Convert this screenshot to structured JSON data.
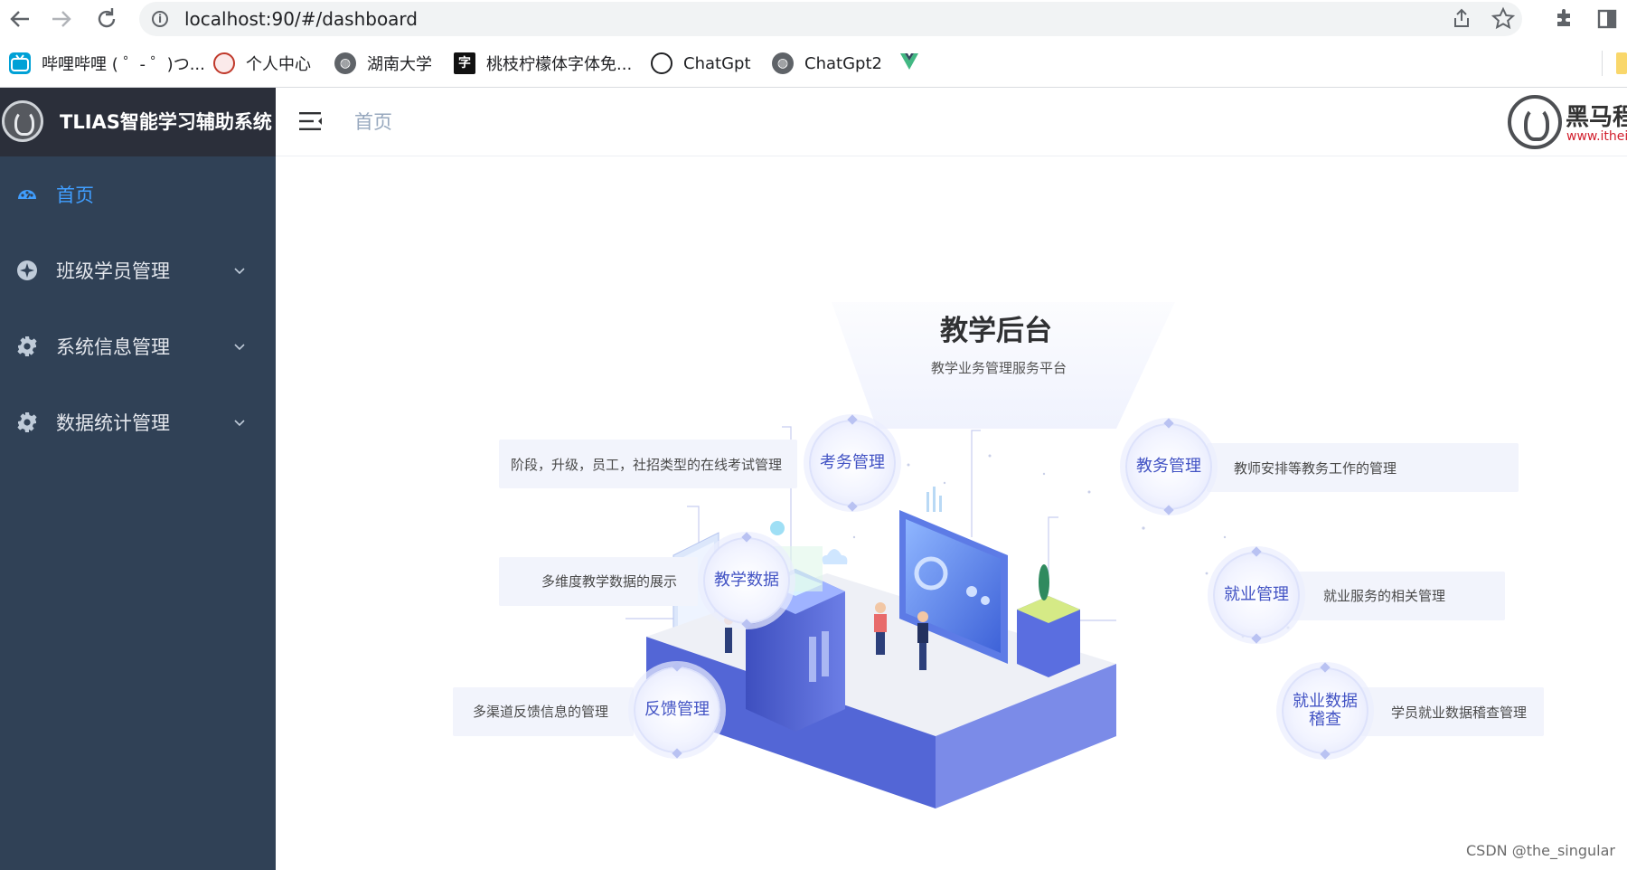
{
  "browser": {
    "url": "localhost:90/#/dashboard",
    "bookmarks": [
      {
        "label": "哔哩哔哩 ( ゜- ゜)つ...",
        "icon": "bilibili-icon",
        "color": "#00a1d6"
      },
      {
        "label": "个人中心",
        "icon": "university-seal-icon",
        "color": "#c0392b"
      },
      {
        "label": "湖南大学",
        "icon": "globe-icon",
        "color": "#5f6368"
      },
      {
        "label": "桃枝柠檬体字体免...",
        "icon": "zi-character-icon",
        "color": "#111111"
      },
      {
        "label": "ChatGpt",
        "icon": "openai-icon",
        "color": "#202124"
      },
      {
        "label": "ChatGpt2",
        "icon": "globe-icon",
        "color": "#5f6368"
      },
      {
        "label": "",
        "icon": "vue-icon",
        "color": "#42b883"
      }
    ]
  },
  "app": {
    "title": "TLIAS智能学习辅助系统",
    "breadcrumb": "首页",
    "corp_name": "黑马程",
    "corp_url": "www.itheir"
  },
  "sidebar": {
    "items": [
      {
        "label": "首页",
        "icon": "dashboard-icon",
        "active": true,
        "has_children": false
      },
      {
        "label": "班级学员管理",
        "icon": "compass-icon",
        "active": false,
        "has_children": true
      },
      {
        "label": "系统信息管理",
        "icon": "gear-icon",
        "active": false,
        "has_children": true
      },
      {
        "label": "数据统计管理",
        "icon": "gear-icon",
        "active": false,
        "has_children": true
      }
    ]
  },
  "dashboard": {
    "title": "教学后台",
    "subtitle": "教学业务管理服务平台",
    "features": [
      {
        "label": "考务管理",
        "desc": "阶段，升级，员工，社招类型的在线考试管理"
      },
      {
        "label": "教学数据",
        "desc": "多维度教学数据的展示"
      },
      {
        "label": "反馈管理",
        "desc": "多渠道反馈信息的管理"
      },
      {
        "label": "教务管理",
        "desc": "教师安排等教务工作的管理"
      },
      {
        "label": "就业管理",
        "desc": "就业服务的相关管理"
      },
      {
        "label": "就业数据\n稽查",
        "desc": "学员就业数据稽查管理"
      }
    ]
  },
  "watermark": "CSDN @the_singular",
  "colors": {
    "sidebar_bg": "#304156",
    "brand_bg": "#2b2f3a",
    "active_menu": "#409eff",
    "accent_blue": "#4253c4"
  }
}
